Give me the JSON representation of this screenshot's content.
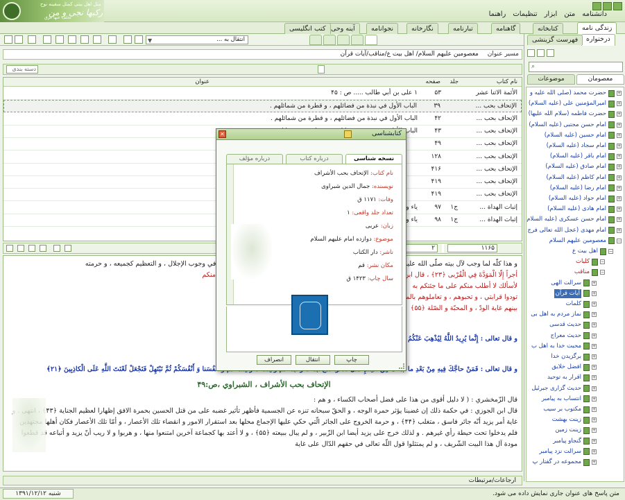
{
  "banner": {
    "line1": "مثل اهل بیتی کمثل سفینه نوح",
    "line2": "من رکبها نجی و من",
    "line3": "تخلف عنها غرق"
  },
  "menu": [
    "دانشنامه",
    "متن",
    "ابزار",
    "تنظیمات",
    "راهنما"
  ],
  "module_tabs": [
    {
      "label": "زندگی نامه",
      "active": true
    },
    {
      "label": "کتابخانه",
      "active": false
    },
    {
      "label": "گاهنامه",
      "active": false
    },
    {
      "label": "تبارنامه",
      "active": false
    },
    {
      "label": "نگارخانه",
      "active": false
    },
    {
      "label": "نجوانامه",
      "active": false
    },
    {
      "label": "آینه وحی",
      "active": false
    },
    {
      "label": "کتب انگلیسی",
      "active": false
    }
  ],
  "toolbar": {
    "goto_label": "انتقال به ..."
  },
  "right_panel": {
    "tabs": [
      {
        "label": "درختواره",
        "active": true
      },
      {
        "label": "فهرست گزینشی",
        "active": false
      }
    ],
    "categories": [
      {
        "label": "معصومان",
        "active": true
      },
      {
        "label": "موضوعات",
        "active": false
      }
    ],
    "tree": [
      {
        "label": "حضرت محمد (صلی الله علیه و",
        "type": "root"
      },
      {
        "label": "امیرالمؤمنین علی (علیه السلام)",
        "type": "root"
      },
      {
        "label": "حضرت فاطمه (سلام الله علیها)",
        "type": "root"
      },
      {
        "label": "امام حسن مجتبی (علیه السلام)",
        "type": "root"
      },
      {
        "label": "امام حسین (علیه السلام)",
        "type": "root"
      },
      {
        "label": "امام سجاد (علیه السلام)",
        "type": "root"
      },
      {
        "label": "امام باقر (علیه السلام)",
        "type": "root"
      },
      {
        "label": "امام صادق (علیه السلام)",
        "type": "root"
      },
      {
        "label": "امام کاظم (علیه السلام)",
        "type": "root"
      },
      {
        "label": "امام رضا (علیه السلام)",
        "type": "root"
      },
      {
        "label": "امام جواد (علیه السلام)",
        "type": "root"
      },
      {
        "label": "امام هادی (علیه السلام)",
        "type": "root"
      },
      {
        "label": "امام حسن عسکری (علیه السلام)",
        "type": "root"
      },
      {
        "label": "امام مهدی (عجل الله تعالی فرج",
        "type": "root"
      },
      {
        "label": "معصومین علیهم السلام",
        "type": "open"
      },
      {
        "label": "اهل بیت ع",
        "type": "l1"
      },
      {
        "label": "کلیات",
        "type": "l2"
      },
      {
        "label": "مناقب",
        "type": "l2"
      },
      {
        "label": "سرالت الهی",
        "type": "l3"
      },
      {
        "label": "آیات قرآن",
        "type": "l3sel"
      },
      {
        "label": "کلمات",
        "type": "l3"
      },
      {
        "label": "نماز مردم به اهل بی",
        "type": "l3"
      },
      {
        "label": "حدیث قدسی",
        "type": "l3"
      },
      {
        "label": "حدیث معراج",
        "type": "l3"
      },
      {
        "label": "محبت خدا به اهل ب",
        "type": "l3"
      },
      {
        "label": "برگزیدن خدا",
        "type": "l3"
      },
      {
        "label": "افضل خلایق",
        "type": "l3"
      },
      {
        "label": "اقرار به توحید",
        "type": "l3"
      },
      {
        "label": "حدیث گزاری جبرئیل",
        "type": "l3"
      },
      {
        "label": "انتساب به پیامبر",
        "type": "l3"
      },
      {
        "label": "مکتوب بر سیب",
        "type": "l3"
      },
      {
        "label": "زینت بهشت",
        "type": "l3"
      },
      {
        "label": "زینت زمین",
        "type": "l3"
      },
      {
        "label": "گنجاو پیامبر",
        "type": "l3"
      },
      {
        "label": "سرالت نزد پیامبر",
        "type": "l3"
      },
      {
        "label": "مجموعه در گفتار پ",
        "type": "l3"
      }
    ]
  },
  "path": {
    "label": "مسیر عنوان",
    "value": "معصومین علیهم السلام/ اهل بیت ع/مناقب/آیات قرآن"
  },
  "group": {
    "label": "دسته بندی"
  },
  "grid": {
    "headers": {
      "book": "نام کتاب",
      "volume": "جلد",
      "page": "صفحه",
      "title": "عنوان"
    },
    "rows": [
      {
        "book": "الأئمة الاثنا عشر",
        "volume": "",
        "page": "۵۳",
        "title": "۱ علی بن أبي طالب ..... ص : ۴۵"
      },
      {
        "book": "الإتحاف بحب ...",
        "volume": "",
        "page": "۳۹",
        "title": "الباب الأول في نبذة من فضائلهم ، و قطرة من شمائلهم ."
      },
      {
        "book": "الإتحاف بحب ...",
        "volume": "",
        "page": "۴۲",
        "title": "الباب الأول في نبذة من فضائلهم ، و قطرة من شمائلهم ."
      },
      {
        "book": "الإتحاف بحب ...",
        "volume": "",
        "page": "۴۳",
        "title": "الباب الأول في نبذة من فضائلهم ، و قطرة من شمائلهم ."
      },
      {
        "book": "الإتحاف بحب ...",
        "volume": "",
        "page": "۴۹",
        "title": ""
      },
      {
        "book": "الإتحاف بحب ...",
        "volume": "",
        "page": "۱۲۸",
        "title": ""
      },
      {
        "book": "الإتحاف بحب ...",
        "volume": "",
        "page": "۴۱۶",
        "title": ""
      },
      {
        "book": "الإتحاف بحب ...",
        "volume": "",
        "page": "۴۱۹",
        "title": ""
      },
      {
        "book": "الإتحاف بحب ...",
        "volume": "",
        "page": "۴۱۹",
        "title": ""
      },
      {
        "book": "إثبات الهداة ...",
        "volume": "ج۱",
        "page": "۹۷",
        "title": "ياء و الأئمة ..... ص : ۹۷"
      },
      {
        "book": "إثبات الهداة ...",
        "volume": "ج۱",
        "page": "۹۸",
        "title": "ياء و الأئمة ..... ص : ۹۷"
      }
    ]
  },
  "pager": {
    "total": "۱۱۶۵",
    "current": "۲"
  },
  "text": {
    "p1": "و هذا كلّه لما وجب لآل بيته صلّى الله عليه و سلّم ، و سريان لحمه ، و دمه الكريمين فيهم ، فهم بعضه ، و بعضه في وجوب الإجلال ، و التعظيم كجميعه ، و حرمته",
    "p2": "أجراً إِلّا الْمَوَدَّةَ فِي الْقُرْبى ﴿٢٣﴾ ، قال ابن عباس : المعنى لا أسألكم عليه أجرا إلّا أن تودّوني في نفسي لقرابتي منكم",
    "p3": "لأسألك لا أطلب منكم على ما جئتكم به",
    "p3b": "تودوا قرابتي ، و تحبوهم ، و تعاملوهم بالمعروف ، و الإحسان ، و يكون بينكم ، و",
    "p4": "بينهم غاية الودّ ، و المحبّة و الصّلة ﴿۵۵﴾",
    "h1": "ص :۴۳",
    "p5": "و قال تعالى : إِنَّما يُرِيدُ اللَّهُ لِيُذْهِبَ عَنْكُمُ",
    "h2": "ص :۴۳",
    "p6": "و قال تعالى : فَمَنْ حاجَّكَ فِيهِ مِنْ بَعْدِ ما جاءَكَ مِنَ الْعِلْمِ فَقُلْ تَعالَوْا نَدْعُ أَبْناءَنا وَ أَبْناءَكُمْ وَ نِساءَنا وَ نِساءَكُمْ وَ أَنْفُسَنا وَ أَنْفُسَكُمْ ثُمَّ نَبْتَهِلْ فَنَجْعَلْ لَعْنَتَ اللَّهِ عَلَى الْكاذِبِينَ ﴿۲۱﴾",
    "h3": "الإتحاف بحب الأشراف ، الشبراوي ،ص:۴۹",
    "p7": "قال الزّمخشري : ( لا دليل أقوى من هذا على فضل أصحاب الكساء ، و هم :",
    "p8": "قال ابن الجوزي : في حكمة ذلك إن غضبنا يؤثر حمرة الوجه ، و الحقّ سبحانه تنزه عن الجسمية فأظهر تأثير غضبه على من قتل الحسين بحمرة الافق إظهارا لعظيم الجناية ﴿۴۳﴾ ، انتهى . و غاية أمر يزيد أنّه جائر فاسق ، متغلب ﴿۴۴﴾ ، و حرمة الخروج على الجائر الّتي حكي عليها الإجماع محلها بعد استقرار الامور و انقضاء تلك الأعصار ، و أمّا تلك الأعصار فكان أهلها مجتهدين فلم يدخلوا تحت حيطة رأي غيرهم . و لذلك خرج على يزيد أيضا ابن الزّبير ، و لم يبال ببيعته ﴿۵۵﴾ ، و لا أعتد بها كجماعة آخرين امتنعوا منها ، و هربوا و لا ريب أنّ يزيد و أتباعه قد قطعوا مودة آل هذا البيت الشّريف ، و لم يمتثلوا قول اللّه تعالى في حقهم الدّال على غاية"
  },
  "footbar": {
    "label": "ارجاعات/مرتبطات"
  },
  "status": {
    "date": "شنبه ۱۳۹۱/۱۲/۱۲",
    "message": "متن پاسخ های عنوان جاری نمایش داده می شود."
  },
  "dialog": {
    "title": "کتابشناسی",
    "tabs": [
      {
        "label": "نسخه شناسی",
        "active": true
      },
      {
        "label": "درباره کتاب",
        "active": false
      },
      {
        "label": "درباره مؤلف",
        "active": false
      }
    ],
    "fields": [
      {
        "k": "نام کتاب:",
        "v": " الإتحاف بحب الأشراف"
      },
      {
        "k": "نویسنده:",
        "v": " جمال الدین شبراوی"
      },
      {
        "k": "وفات:",
        "v": " ۱۱۷۱ ق"
      },
      {
        "k": "تعداد جلد واقعی:",
        "v": " ۱"
      },
      {
        "k": "زبان:",
        "v": " عربی"
      },
      {
        "k": "موضوع:",
        "v": " دوازده امام علیهم السلام"
      },
      {
        "k": "ناشر:",
        "v": " دار الکتاب"
      },
      {
        "k": "مکان نشر:",
        "v": " قم"
      },
      {
        "k": "سال چاپ:",
        "v": " ۱۴۲۳ ق"
      }
    ],
    "buttons": {
      "print": "چاپ",
      "transfer": "انتقال",
      "cancel": "انصراف"
    }
  }
}
